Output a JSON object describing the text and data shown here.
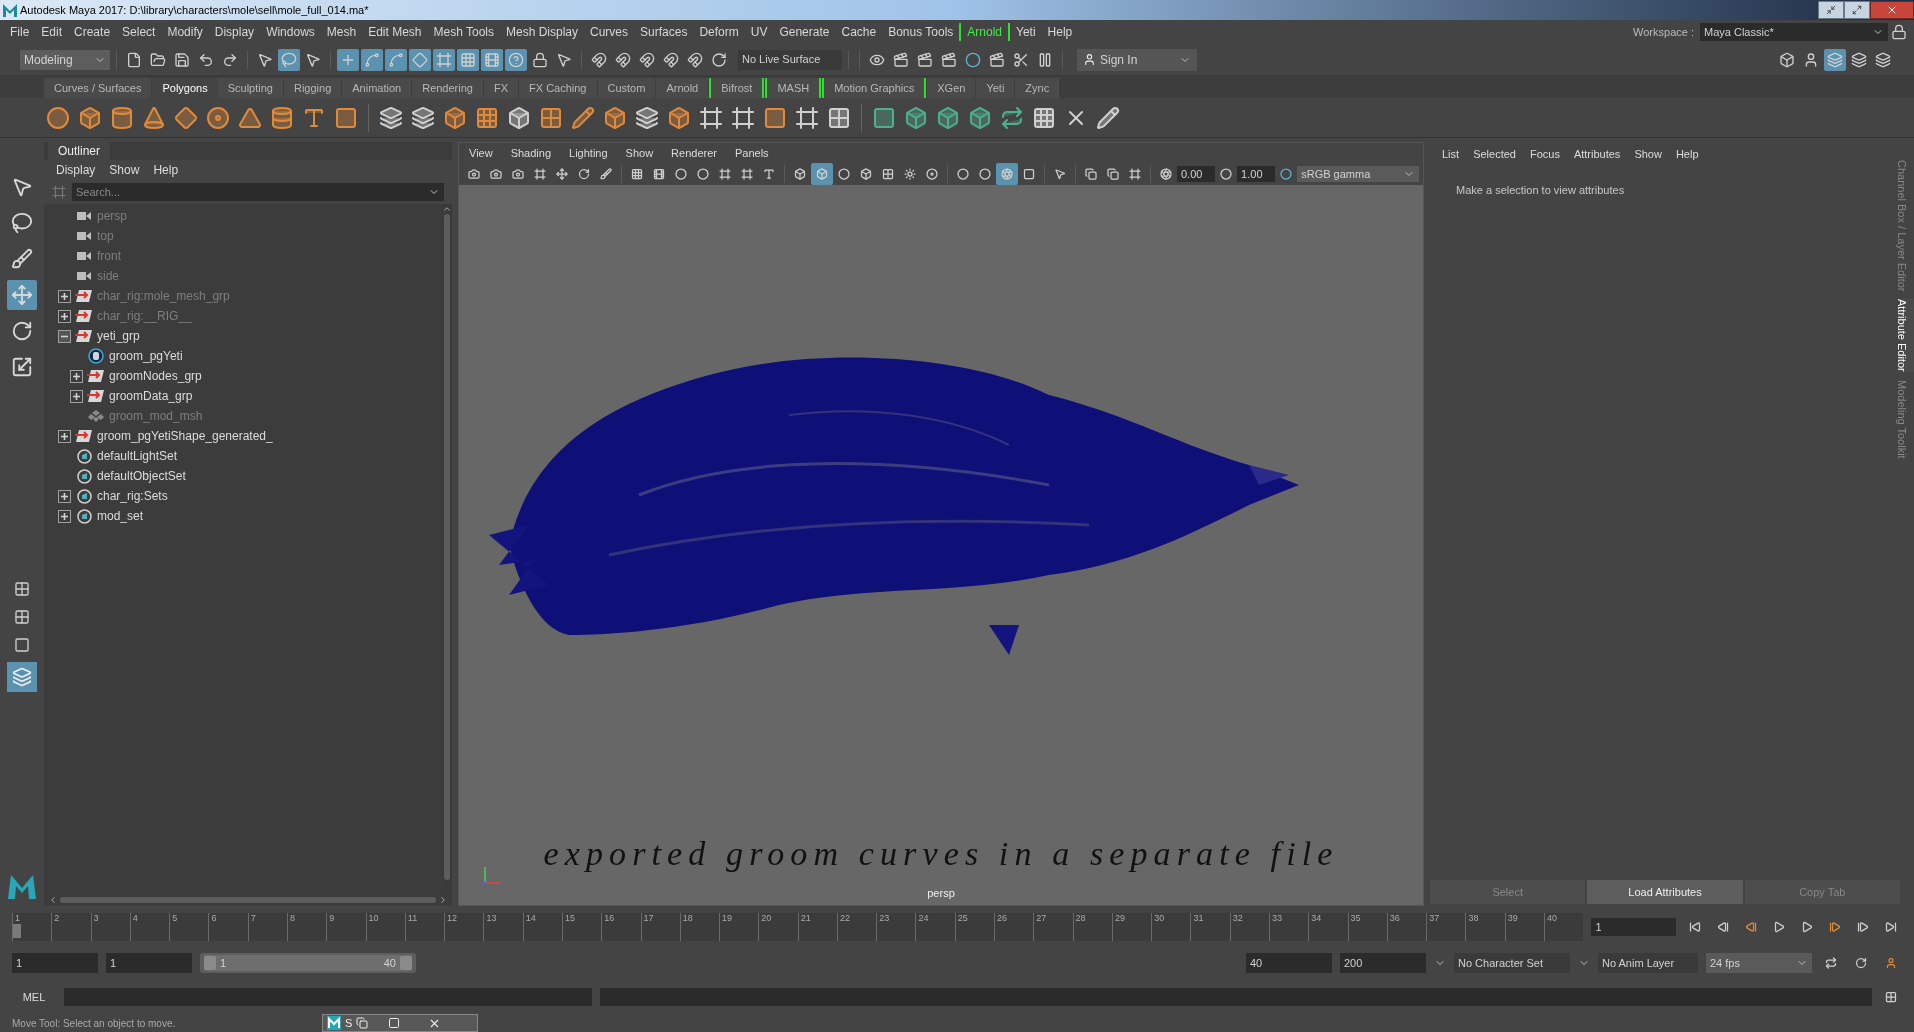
{
  "window": {
    "title": "Autodesk Maya 2017: D:\\library\\characters\\mole\\sell\\mole_full_014.ma*"
  },
  "menu": [
    {
      "label": "File",
      "highlighted": false
    },
    {
      "label": "Edit",
      "highlighted": false
    },
    {
      "label": "Create",
      "highlighted": false
    },
    {
      "label": "Select",
      "highlighted": false
    },
    {
      "label": "Modify",
      "highlighted": false
    },
    {
      "label": "Display",
      "highlighted": false
    },
    {
      "label": "Windows",
      "highlighted": false
    },
    {
      "label": "Mesh",
      "highlighted": false
    },
    {
      "label": "Edit Mesh",
      "highlighted": false
    },
    {
      "label": "Mesh Tools",
      "highlighted": false
    },
    {
      "label": "Mesh Display",
      "highlighted": false
    },
    {
      "label": "Curves",
      "highlighted": false
    },
    {
      "label": "Surfaces",
      "highlighted": false
    },
    {
      "label": "Deform",
      "highlighted": false
    },
    {
      "label": "UV",
      "highlighted": false
    },
    {
      "label": "Generate",
      "highlighted": false
    },
    {
      "label": "Cache",
      "highlighted": false
    },
    {
      "label": "Bonus Tools",
      "highlighted": false
    },
    {
      "label": "Arnold",
      "highlighted": true
    },
    {
      "label": "Yeti",
      "highlighted": false
    },
    {
      "label": "Help",
      "highlighted": false
    }
  ],
  "workspace": {
    "label": "Workspace :",
    "value": "Maya Classic*"
  },
  "status_line": {
    "mode": "Modeling",
    "live_surface": "No Live Surface",
    "sign_in": "Sign In"
  },
  "shelf_tabs": [
    {
      "label": "Curves / Surfaces",
      "selected": false,
      "highlighted": false
    },
    {
      "label": "Polygons",
      "selected": true,
      "highlighted": false
    },
    {
      "label": "Sculpting",
      "selected": false,
      "highlighted": false
    },
    {
      "label": "Rigging",
      "selected": false,
      "highlighted": false
    },
    {
      "label": "Animation",
      "selected": false,
      "highlighted": false
    },
    {
      "label": "Rendering",
      "selected": false,
      "highlighted": false
    },
    {
      "label": "FX",
      "selected": false,
      "highlighted": false
    },
    {
      "label": "FX Caching",
      "selected": false,
      "highlighted": false
    },
    {
      "label": "Custom",
      "selected": false,
      "highlighted": false
    },
    {
      "label": "Arnold",
      "selected": false,
      "highlighted": false
    },
    {
      "label": "Bifrost",
      "selected": false,
      "highlighted": true
    },
    {
      "label": "MASH",
      "selected": false,
      "highlighted": true
    },
    {
      "label": "Motion Graphics",
      "selected": false,
      "highlighted": true
    },
    {
      "label": "XGen",
      "selected": false,
      "highlighted": false
    },
    {
      "label": "Yeti",
      "selected": false,
      "highlighted": false
    },
    {
      "label": "Zync",
      "selected": false,
      "highlighted": false
    }
  ],
  "tools": [
    {
      "kind": "select",
      "selected": false
    },
    {
      "kind": "lasso",
      "selected": false
    },
    {
      "kind": "paint",
      "selected": false
    },
    {
      "kind": "move",
      "selected": true
    },
    {
      "kind": "rotate",
      "selected": false
    },
    {
      "kind": "scale",
      "selected": false
    }
  ],
  "outliner": {
    "title": "Outliner",
    "menu": [
      "Display",
      "Show",
      "Help"
    ],
    "search": {
      "placeholder": "Search..."
    },
    "items": [
      {
        "label": "persp",
        "kind": "camera",
        "dimmed": true,
        "expandable": false
      },
      {
        "label": "top",
        "kind": "camera",
        "dimmed": true,
        "expandable": false
      },
      {
        "label": "front",
        "kind": "camera",
        "dimmed": true,
        "expandable": false
      },
      {
        "label": "side",
        "kind": "camera",
        "dimmed": true,
        "expandable": false
      },
      {
        "label": "char_rig:mole_mesh_grp",
        "kind": "group",
        "dimmed": true,
        "expandable": true,
        "expanded": false
      },
      {
        "label": "char_rig:__RIG__",
        "kind": "group",
        "dimmed": true,
        "expandable": true,
        "expanded": false
      },
      {
        "label": "yeti_grp",
        "kind": "group",
        "dimmed": false,
        "expandable": true,
        "expanded": true,
        "children": [
          {
            "label": "groom_pgYeti",
            "kind": "yeti",
            "dimmed": false,
            "expandable": false
          },
          {
            "label": "groomNodes_grp",
            "kind": "group",
            "dimmed": false,
            "expandable": true,
            "expanded": false
          },
          {
            "label": "groomData_grp",
            "kind": "group",
            "dimmed": false,
            "expandable": true,
            "expanded": false
          },
          {
            "label": "groom_mod_msh",
            "kind": "mesh",
            "dimmed": true,
            "expandable": false
          }
        ]
      },
      {
        "label": "groom_pgYetiShape_generated_",
        "kind": "group",
        "dimmed": false,
        "expandable": true,
        "expanded": false
      },
      {
        "label": "defaultLightSet",
        "kind": "set",
        "dimmed": false,
        "expandable": false
      },
      {
        "label": "defaultObjectSet",
        "kind": "set",
        "dimmed": false,
        "expandable": false
      },
      {
        "label": "char_rig:Sets",
        "kind": "set",
        "dimmed": false,
        "expandable": true,
        "expanded": false
      },
      {
        "label": "mod_set",
        "kind": "set",
        "dimmed": false,
        "expandable": true,
        "expanded": false
      }
    ]
  },
  "viewport": {
    "menu": [
      "View",
      "Shading",
      "Lighting",
      "Show",
      "Renderer",
      "Panels"
    ],
    "exposure": "0.00",
    "gamma": "1.00",
    "color_space": "sRGB gamma",
    "annotation": "exported groom curves in a separate file",
    "camera": "persp"
  },
  "attribute_editor": {
    "menu": [
      "List",
      "Selected",
      "Focus",
      "Attributes",
      "Show",
      "Help"
    ],
    "message": "Make a selection to view attributes",
    "buttons": [
      {
        "label": "Select",
        "disabled": true
      },
      {
        "label": "Load Attributes",
        "disabled": false
      },
      {
        "label": "Copy Tab",
        "disabled": true
      }
    ]
  },
  "side_tabs": [
    {
      "label": "Channel Box / Layer Editor",
      "selected": false
    },
    {
      "label": "Attribute Editor",
      "selected": true
    },
    {
      "label": "Modeling Toolkit",
      "selected": false
    }
  ],
  "timeline": {
    "frames": [
      {
        "label": "1",
        "selected": true
      },
      {
        "label": "2",
        "selected": false
      },
      {
        "label": "3",
        "selected": false
      },
      {
        "label": "4",
        "selected": false
      },
      {
        "label": "5",
        "selected": false
      },
      {
        "label": "6",
        "selected": false
      },
      {
        "label": "7",
        "selected": false
      },
      {
        "label": "8",
        "selected": false
      },
      {
        "label": "9",
        "selected": false
      },
      {
        "label": "10",
        "selected": false
      },
      {
        "label": "11",
        "selected": false
      },
      {
        "label": "12",
        "selected": false
      },
      {
        "label": "13",
        "selected": false
      },
      {
        "label": "14",
        "selected": false
      },
      {
        "label": "15",
        "selected": false
      },
      {
        "label": "16",
        "selected": false
      },
      {
        "label": "17",
        "selected": false
      },
      {
        "label": "18",
        "selected": false
      },
      {
        "label": "19",
        "selected": false
      },
      {
        "label": "20",
        "selected": false
      },
      {
        "label": "21",
        "selected": false
      },
      {
        "label": "22",
        "selected": false
      },
      {
        "label": "23",
        "selected": false
      },
      {
        "label": "24",
        "selected": false
      },
      {
        "label": "25",
        "selected": false
      },
      {
        "label": "26",
        "selected": false
      },
      {
        "label": "27",
        "selected": false
      },
      {
        "label": "28",
        "selected": false
      },
      {
        "label": "29",
        "selected": false
      },
      {
        "label": "30",
        "selected": false
      },
      {
        "label": "31",
        "selected": false
      },
      {
        "label": "32",
        "selected": false
      },
      {
        "label": "33",
        "selected": false
      },
      {
        "label": "34",
        "selected": false
      },
      {
        "label": "35",
        "selected": false
      },
      {
        "label": "36",
        "selected": false
      },
      {
        "label": "37",
        "selected": false
      },
      {
        "label": "38",
        "selected": false
      },
      {
        "label": "39",
        "selected": false
      },
      {
        "label": "40",
        "selected": false
      }
    ],
    "current_frame": "1"
  },
  "range": {
    "level": 1,
    "start": "1",
    "playback_start": "1",
    "slider_start": "1",
    "slider_end": "40",
    "playback_end": "40",
    "end": "200",
    "character_set": "No Character Set",
    "anim_layer": "No Anim Layer",
    "fps": "24 fps"
  },
  "command_line": {
    "language": "MEL"
  },
  "help_line": "Move Tool: Select an object to move.",
  "mini_window": {
    "label": "S"
  }
}
